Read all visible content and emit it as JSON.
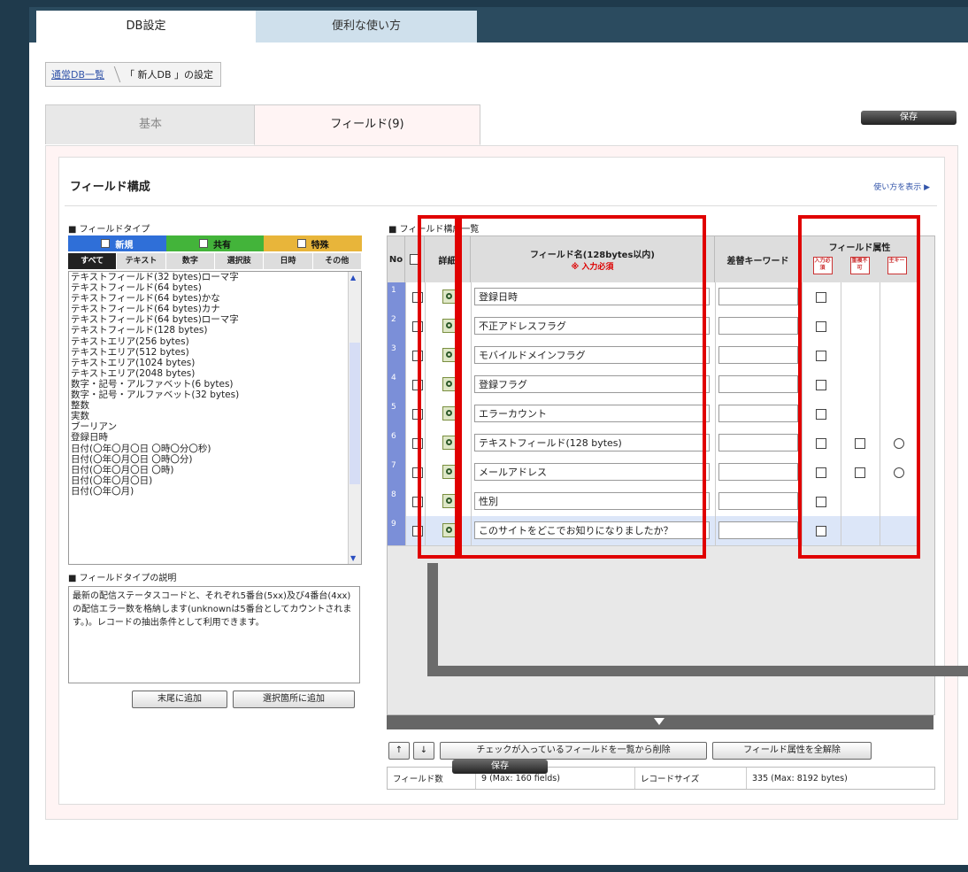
{
  "top_tabs": {
    "db_settings": "DB設定",
    "howto": "便利な使い方"
  },
  "breadcrumb": {
    "list": "通常DB一覧",
    "current": "「 新人DB 」の設定"
  },
  "sub_tabs": {
    "basic": "基本",
    "fields": "フィールド(9)"
  },
  "save_label": "保存",
  "section": {
    "title": "フィールド構成",
    "howto_link": "使い方を表示 ▶"
  },
  "field_type": {
    "label": "■ フィールドタイプ",
    "categories": [
      "新規",
      "共有",
      "特殊"
    ],
    "tabs": [
      "すべて",
      "テキスト",
      "数字",
      "選択肢",
      "日時",
      "その他"
    ],
    "items": [
      "テキストフィールド(32 bytes)ローマ字",
      "テキストフィールド(64 bytes)",
      "テキストフィールド(64 bytes)かな",
      "テキストフィールド(64 bytes)カナ",
      "テキストフィールド(64 bytes)ローマ字",
      "テキストフィールド(128 bytes)",
      "テキストエリア(256 bytes)",
      "テキストエリア(512 bytes)",
      "テキストエリア(1024 bytes)",
      "テキストエリア(2048 bytes)",
      "数字・記号・アルファベット(6 bytes)",
      "数字・記号・アルファベット(32 bytes)",
      "整数",
      "実数",
      "ブーリアン",
      "登録日時",
      "日付(〇年〇月〇日 〇時〇分〇秒)",
      "日付(〇年〇月〇日 〇時〇分)",
      "日付(〇年〇月〇日 〇時)",
      "日付(〇年〇月〇日)",
      "日付(〇年〇月)"
    ],
    "desc_label": "■ フィールドタイプの説明",
    "description": "最新の配信ステータスコードと、それぞれ5番台(5xx)及び4番台(4xx)の配信エラー数を格納します(unknownは5番台としてカウントされます。)。レコードの抽出条件として利用できます。",
    "add_end": "末尾に追加",
    "add_selected": "選択箇所に追加"
  },
  "field_list": {
    "label": "■ フィールド構成一覧",
    "headers": {
      "no": "No",
      "detail": "詳細",
      "name": "フィールド名(128bytes以内)",
      "name_note": "※ 入力必須",
      "keyword": "差替キーワード",
      "attr": "フィールド属性",
      "attr_required": "入力必須",
      "attr_nodup": "重複不可",
      "attr_key": "主キー"
    },
    "rows": [
      {
        "no": "1",
        "name": "登録日時",
        "extra": false
      },
      {
        "no": "2",
        "name": "不正アドレスフラグ",
        "extra": false
      },
      {
        "no": "3",
        "name": "モバイルドメインフラグ",
        "extra": false
      },
      {
        "no": "4",
        "name": "登録フラグ",
        "extra": false
      },
      {
        "no": "5",
        "name": "エラーカウント",
        "extra": false
      },
      {
        "no": "6",
        "name": "テキストフィールド(128 bytes)",
        "extra": true
      },
      {
        "no": "7",
        "name": "メールアドレス",
        "extra": true
      },
      {
        "no": "8",
        "name": "性別",
        "extra": false
      },
      {
        "no": "9",
        "name": "このサイトをどこでお知りになりましたか？",
        "extra": false
      }
    ],
    "btn_up": "↑",
    "btn_down": "↓",
    "btn_delete": "チェックが入っているフィールドを一覧から削除",
    "btn_clear": "フィールド属性を全解除",
    "stats": {
      "count_label": "フィールド数",
      "count_value": "9 (Max: 160 fields)",
      "size_label": "レコードサイズ",
      "size_value": "335 (Max: 8192 bytes)"
    }
  },
  "colors": {
    "highlight": "#e00000",
    "cat_new": "#2f6fd8",
    "cat_shared": "#43b43a",
    "cat_special": "#e8b53a"
  }
}
